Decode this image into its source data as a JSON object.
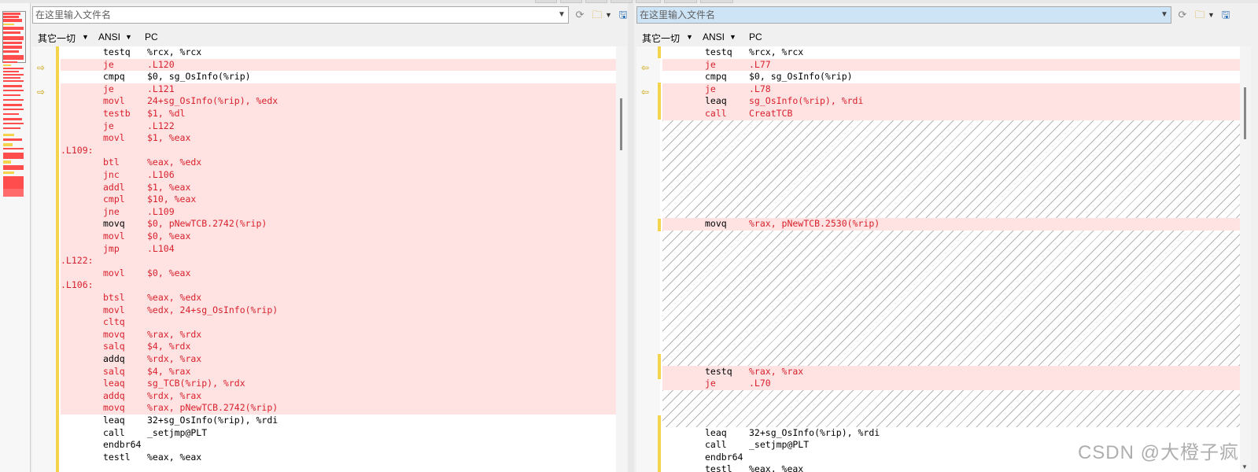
{
  "left": {
    "path_placeholder": "在这里输入文件名",
    "menus": {
      "mode": "其它一切",
      "encoding": "ANSI",
      "line_ending": "PC"
    },
    "lines": [
      {
        "type": "same",
        "mn": "testq",
        "op": "%rcx, %rcx"
      },
      {
        "type": "diff",
        "mn": "je",
        "op": ".L120"
      },
      {
        "type": "same",
        "mn": "cmpq",
        "op": "$0, sg_OsInfo(%rip)"
      },
      {
        "type": "diff",
        "mn": "je",
        "op": ".L121"
      },
      {
        "type": "diff",
        "mn": "movl",
        "op": "24+sg_OsInfo(%rip), %edx"
      },
      {
        "type": "diff",
        "mn": "testb",
        "op": "$1, %dl"
      },
      {
        "type": "diff",
        "mn": "je",
        "op": ".L122"
      },
      {
        "type": "diff",
        "mn": "movl",
        "op": "$1, %eax"
      },
      {
        "type": "label",
        "lb": ".L109:"
      },
      {
        "type": "diff",
        "mn": "btl",
        "op": "%eax, %edx"
      },
      {
        "type": "diff",
        "mn": "jnc",
        "op": ".L106"
      },
      {
        "type": "diff",
        "mn": "addl",
        "op": "$1, %eax"
      },
      {
        "type": "diff",
        "mn": "cmpl",
        "op": "$10, %eax"
      },
      {
        "type": "diff",
        "mn": "jne",
        "op": ".L109"
      },
      {
        "type": "diffmix",
        "mn": "movq",
        "op": "$0, pNewTCB.2742(%rip)"
      },
      {
        "type": "diff",
        "mn": "movl",
        "op": "$0, %eax"
      },
      {
        "type": "diff",
        "mn": "jmp",
        "op": ".L104"
      },
      {
        "type": "label",
        "lb": ".L122:"
      },
      {
        "type": "diff",
        "mn": "movl",
        "op": "$0, %eax"
      },
      {
        "type": "label",
        "lb": ".L106:"
      },
      {
        "type": "diff",
        "mn": "btsl",
        "op": "%eax, %edx"
      },
      {
        "type": "diff",
        "mn": "movl",
        "op": "%edx, 24+sg_OsInfo(%rip)"
      },
      {
        "type": "diff",
        "mn": "cltq",
        "op": ""
      },
      {
        "type": "diff",
        "mn": "movq",
        "op": "%rax, %rdx"
      },
      {
        "type": "diff",
        "mn": "salq",
        "op": "$4, %rdx"
      },
      {
        "type": "diffmix",
        "mn": "addq",
        "op": "%rdx, %rax"
      },
      {
        "type": "diff",
        "mn": "salq",
        "op": "$4, %rax"
      },
      {
        "type": "diff",
        "mn": "leaq",
        "op": "sg_TCB(%rip), %rdx"
      },
      {
        "type": "diff",
        "mn": "addq",
        "op": "%rdx, %rax"
      },
      {
        "type": "diff",
        "mn": "movq",
        "op": "%rax, pNewTCB.2742(%rip)"
      },
      {
        "type": "same",
        "mn": "leaq",
        "op": "32+sg_OsInfo(%rip), %rdi"
      },
      {
        "type": "same",
        "mn": "call",
        "op": "_setjmp@PLT"
      },
      {
        "type": "same",
        "mn": "endbr64",
        "op": ""
      },
      {
        "type": "same",
        "mn": "testl",
        "op": "%eax, %eax"
      }
    ]
  },
  "right": {
    "path_placeholder": "在这里输入文件名",
    "menus": {
      "mode": "其它一切",
      "encoding": "ANSI",
      "line_ending": "PC"
    },
    "lines": [
      {
        "type": "same",
        "mn": "testq",
        "op": "%rcx, %rcx"
      },
      {
        "type": "diff",
        "mn": "je",
        "op": ".L77"
      },
      {
        "type": "same",
        "mn": "cmpq",
        "op": "$0, sg_OsInfo(%rip)"
      },
      {
        "type": "diff",
        "mn": "je",
        "op": ".L78"
      },
      {
        "type": "diffmix",
        "mn": "leaq",
        "op": "sg_OsInfo(%rip), %rdi"
      },
      {
        "type": "diff",
        "mn": "call",
        "op": "CreatTCB"
      },
      {
        "type": "gap"
      },
      {
        "type": "gap"
      },
      {
        "type": "gap"
      },
      {
        "type": "gap"
      },
      {
        "type": "gap"
      },
      {
        "type": "gap"
      },
      {
        "type": "gap"
      },
      {
        "type": "gap"
      },
      {
        "type": "diffmix",
        "mn": "movq",
        "op": "%rax, pNewTCB.2530(%rip)"
      },
      {
        "type": "gap"
      },
      {
        "type": "gap"
      },
      {
        "type": "gap"
      },
      {
        "type": "gap"
      },
      {
        "type": "gap"
      },
      {
        "type": "gap"
      },
      {
        "type": "gap"
      },
      {
        "type": "gap"
      },
      {
        "type": "gap"
      },
      {
        "type": "gap"
      },
      {
        "type": "gap"
      },
      {
        "type": "diffmix",
        "mn": "testq",
        "op": "%rax, %rax"
      },
      {
        "type": "diff",
        "mn": "je",
        "op": ".L70"
      },
      {
        "type": "gap"
      },
      {
        "type": "gap"
      },
      {
        "type": "gap"
      },
      {
        "type": "same",
        "mn": "leaq",
        "op": "32+sg_OsInfo(%rip), %rdi"
      },
      {
        "type": "same",
        "mn": "call",
        "op": "_setjmp@PLT"
      },
      {
        "type": "same",
        "mn": "endbr64",
        "op": ""
      },
      {
        "type": "same",
        "mn": "testl",
        "op": "%eax, %eax"
      }
    ]
  },
  "watermark": "CSDN @大橙子疯",
  "colors": {
    "diff_bg": "#ffe3e3",
    "diff_text": "#d8202c",
    "marker": "#f4d44c"
  },
  "icons": [
    "chevron-down-icon",
    "refresh-icon",
    "open-folder-icon",
    "save-icon",
    "next-diff-arrow-icon",
    "prev-diff-arrow-icon"
  ]
}
